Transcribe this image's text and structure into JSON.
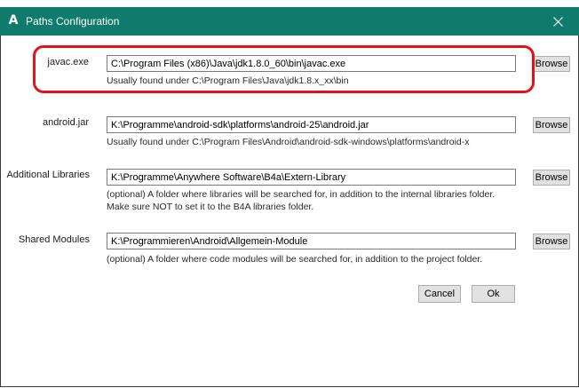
{
  "window": {
    "title": "Paths Configuration",
    "app_icon": "A",
    "accent_color": "#0f7b6c"
  },
  "fields": {
    "javac": {
      "label": "javac.exe",
      "value": "C:\\Program Files (x86)\\Java\\jdk1.8.0_60\\bin\\javac.exe",
      "hint": "Usually found under C:\\Program Files\\Java\\jdk1.8.x_xx\\bin",
      "browse_label": "Browse"
    },
    "android_jar": {
      "label": "android.jar",
      "value": "K:\\Programme\\android-sdk\\platforms\\android-25\\android.jar",
      "hint": "Usually found under C:\\Program Files\\Android\\android-sdk-windows\\platforms\\android-x",
      "browse_label": "Browse"
    },
    "additional_libraries": {
      "label": "Additional Libraries",
      "value": "K:\\Programme\\Anywhere Software\\B4a\\Extern-Library",
      "hint_line1": "(optional) A folder where libraries will be searched for, in addition to the internal libraries folder.",
      "hint_line2": "Make sure NOT to set it to the B4A libraries folder.",
      "browse_label": "Browse"
    },
    "shared_modules": {
      "label": "Shared Modules",
      "value": "K:\\Programmieren\\Android\\Allgemein-Module",
      "hint": "(optional) A folder where code modules will be searched for, in addition to the project folder.",
      "browse_label": "Browse"
    }
  },
  "actions": {
    "cancel_label": "Cancel",
    "ok_label": "Ok"
  }
}
